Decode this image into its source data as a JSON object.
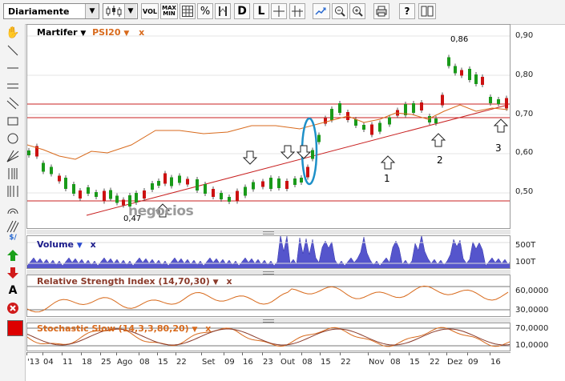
{
  "toolbar": {
    "period": "Diariamente",
    "buttons": [
      "VOL",
      "MAX MIN",
      "%",
      "D",
      "L"
    ]
  },
  "main": {
    "symbol": "Martifer",
    "indicator": "PSI20",
    "close_x": "x",
    "y_ticks": [
      "0,90",
      "0,80",
      "0,70",
      "0,60",
      "0,50"
    ],
    "price_high_label": "0,86",
    "price_low_label": "0,47",
    "annotations": [
      "1",
      "2",
      "3"
    ],
    "watermark": "negocios"
  },
  "volume": {
    "title": "Volume",
    "close_x": "x",
    "y_ticks": [
      "500T",
      "100T"
    ]
  },
  "rsi": {
    "title": "Relative Strength Index (14,70,30)",
    "close_x": "x",
    "y_ticks": [
      "60,0000",
      "30,0000"
    ]
  },
  "stoch": {
    "title": "Stochastic Slow (14,3,3,80,20)",
    "close_x": "x",
    "y_ticks": [
      "70,0000",
      "10,0000"
    ]
  },
  "x_labels": [
    "'13",
    "04",
    "11",
    "18",
    "25",
    "Ago",
    "08",
    "15",
    "22",
    "Set",
    "09",
    "16",
    "23",
    "Out",
    "08",
    "15",
    "22",
    "Nov",
    "08",
    "15",
    "22",
    "Dez",
    "09",
    "16"
  ],
  "colors": {
    "up": "#1a9a1a",
    "down": "#cc1111",
    "psi": "#d86a1c",
    "volume": "#5555cc",
    "trendline": "#c82020",
    "highlight": "#1e90c8"
  }
}
